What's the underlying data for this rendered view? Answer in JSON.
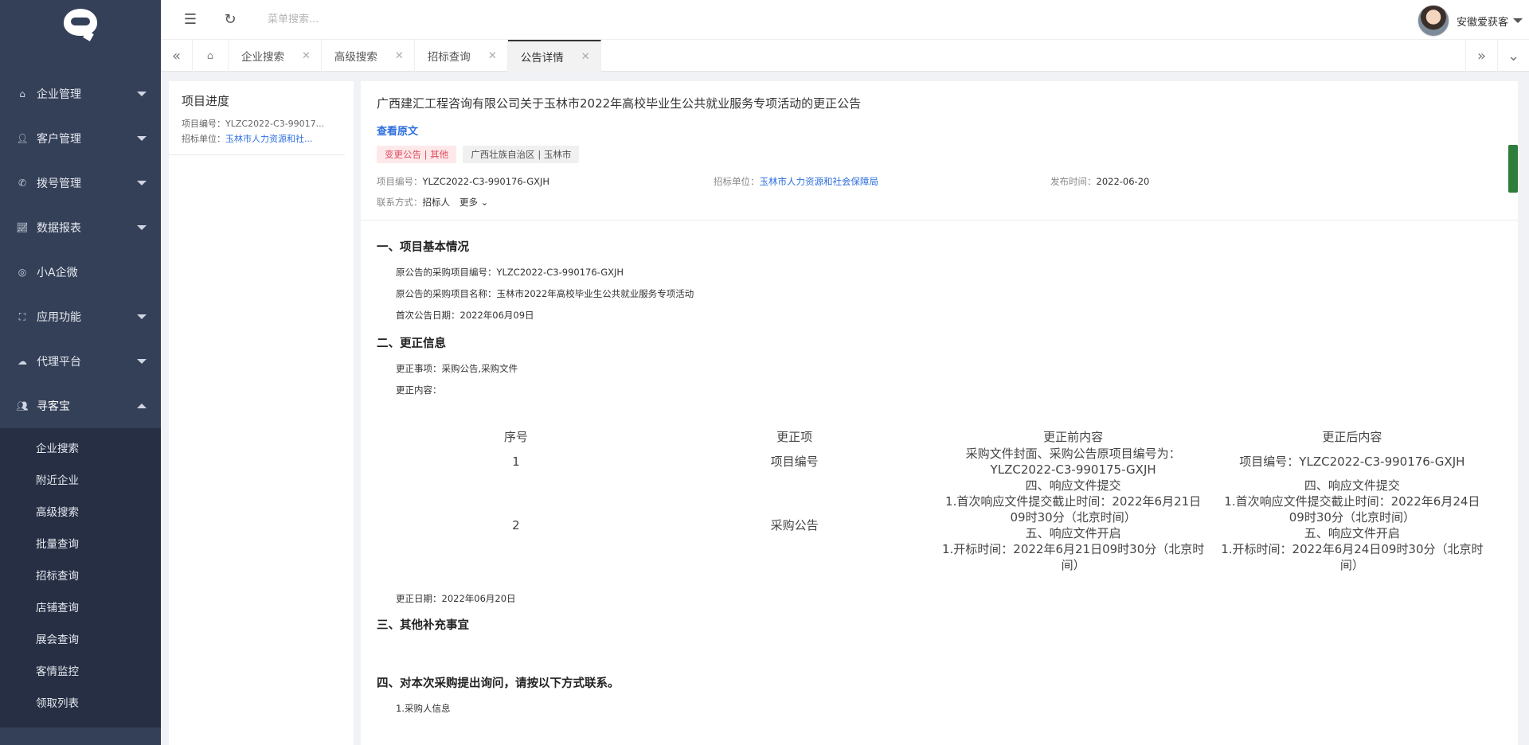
{
  "sidebar": {
    "menu": [
      {
        "label": "企业管理",
        "icon": "home-icon"
      },
      {
        "label": "客户管理",
        "icon": "user-icon"
      },
      {
        "label": "拨号管理",
        "icon": "phone-icon"
      },
      {
        "label": "数据报表",
        "icon": "chart-icon"
      },
      {
        "label": "小A企微",
        "icon": "chat-icon"
      },
      {
        "label": "应用功能",
        "icon": "grid-icon"
      },
      {
        "label": "代理平台",
        "icon": "cloud-icon"
      },
      {
        "label": "寻客宝",
        "icon": "users-icon"
      }
    ],
    "submenu": [
      "企业搜索",
      "附近企业",
      "高级搜索",
      "批量查询",
      "招标查询",
      "店铺查询",
      "展会查询",
      "客情监控",
      "领取列表"
    ]
  },
  "topbar": {
    "search_placeholder": "菜单搜索...",
    "user_name": "安徽爱获客"
  },
  "tabs": [
    {
      "label": "企业搜索"
    },
    {
      "label": "高级搜索"
    },
    {
      "label": "招标查询"
    },
    {
      "label": "公告详情"
    }
  ],
  "left_panel": {
    "title": "项目进度",
    "project_no_label": "项目编号：",
    "project_no": "YLZC2022-C3-99017...",
    "unit_label": "招标单位：",
    "unit": "玉林市人力资源和社..."
  },
  "notice": {
    "title": "广西建汇工程咨询有限公司关于玉林市2022年高校毕业生公共就业服务专项活动的更正公告",
    "view_original": "查看原文",
    "tag_type": "变更公告 | 其他",
    "tag_region": "广西壮族自治区 | 玉林市",
    "project_no_label": "项目编号：",
    "project_no": "YLZC2022-C3-990176-GXJH",
    "unit_label": "招标单位：",
    "unit": "玉林市人力资源和社会保障局",
    "date_label": "发布时间：",
    "date": "2022-06-20",
    "contact_label": "联系方式：",
    "contact": "招标人",
    "more": "更多"
  },
  "content": {
    "sec1": "一、项目基本情况",
    "sec1_p1": "原公告的采购项目编号：YLZC2022-C3-990176-GXJH",
    "sec1_p2": "原公告的采购项目名称：玉林市2022年高校毕业生公共就业服务专项活动",
    "sec1_p3": "首次公告日期：2022年06月09日",
    "sec2": "二、更正信息",
    "sec2_p1": "更正事项：采购公告,采购文件",
    "sec2_p2": "更正内容：",
    "table_headers": [
      "序号",
      "更正项",
      "更正前内容",
      "更正后内容"
    ],
    "rows": [
      {
        "no": "1",
        "item": "项目编号",
        "before": "采购文件封面、采购公告原项目编号为：YLZC2022-C3-990175-GXJH",
        "after": "项目编号：YLZC2022-C3-990176-GXJH"
      },
      {
        "no": "2",
        "item": "采购公告",
        "before": "四、响应文件提交\n1.首次响应文件提交截止时间：2022年6月21日09时30分（北京时间）\n五、响应文件开启\n1.开标时间：2022年6月21日09时30分（北京时间）",
        "after": "四、响应文件提交\n1.首次响应文件提交截止时间：2022年6月24日09时30分（北京时间）\n五、响应文件开启\n1.开标时间：2022年6月24日09时30分（北京时间）"
      }
    ],
    "sec2_date": "更正日期：2022年06月20日",
    "sec3": "三、其他补充事宜",
    "sec4": "四、对本次采购提出询问，请按以下方式联系。",
    "sec4_p1": "1.采购人信息"
  }
}
